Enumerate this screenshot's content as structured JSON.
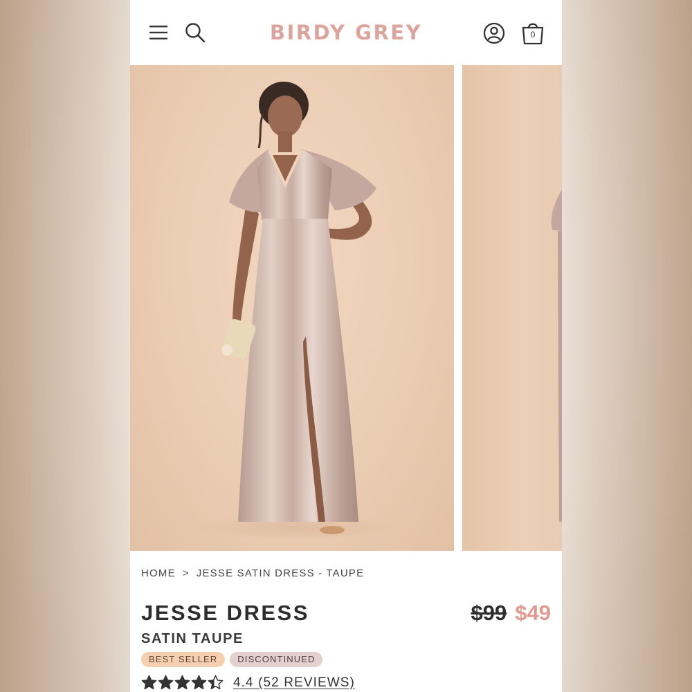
{
  "header": {
    "logo": "BIRDY GREY",
    "icons": {
      "menu": "hamburger-menu-icon",
      "search": "search-icon",
      "account": "user-account-icon",
      "cart": "shopping-bag-icon"
    },
    "cart_count": "0"
  },
  "gallery": {
    "images": [
      {
        "subject": "model-in-satin-dress-photo"
      },
      {
        "subject": "next-product-photo-partial"
      }
    ]
  },
  "breadcrumb": {
    "items": [
      "HOME",
      "JESSE SATIN DRESS - TAUPE"
    ],
    "separator": ">"
  },
  "product": {
    "title": "JESSE DRESS",
    "variant": "SATIN TAUPE",
    "price_original": "$99",
    "price_sale": "$49",
    "badges": [
      "BEST SELLER",
      "DISCONTINUED"
    ],
    "rating_value": 4.4,
    "rating_text": "4.4 (52 REVIEWS)"
  },
  "colors": {
    "brand_accent": "#dba59e",
    "sale_price": "#e09a8f",
    "badge_best_seller": "#f6cfae",
    "badge_discontinued": "#e3d0cd",
    "text_dark": "#2d2d2d",
    "photo_background": "#ebcdb3",
    "dress": "#c9ada2"
  }
}
